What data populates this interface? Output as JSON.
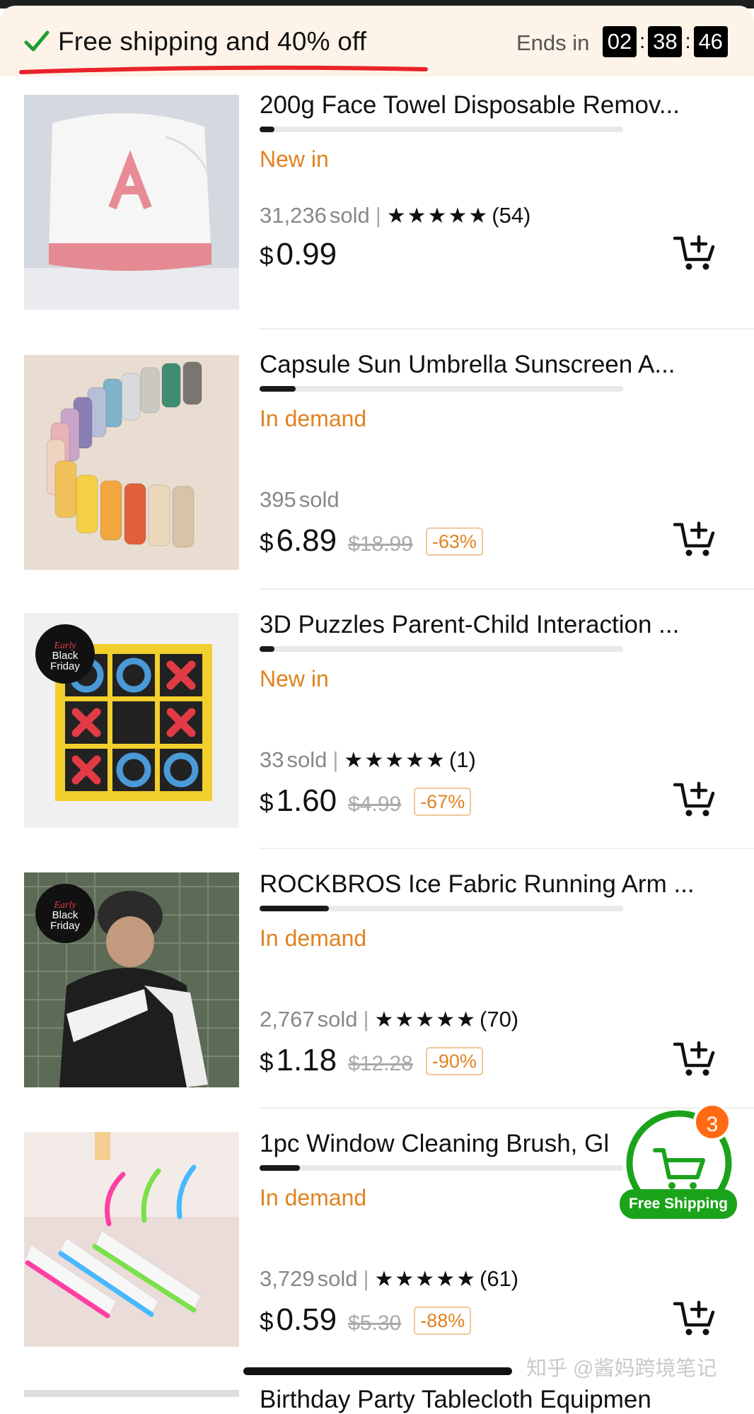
{
  "banner": {
    "shipping_text": "Free shipping and 40% off",
    "ends_label": "Ends in",
    "timer": [
      "02",
      "38",
      "46"
    ]
  },
  "products": [
    {
      "title": "200g Face Towel Disposable Remov...",
      "progress": 0.04,
      "tag": "New in",
      "sold_num": "31,236",
      "sold_label": "sold",
      "stars": "★★★★★",
      "reviews": "(54)",
      "currency": "$",
      "price": "0.99",
      "original_price": "",
      "discount": ""
    },
    {
      "title": "Capsule Sun Umbrella Sunscreen A...",
      "progress": 0.1,
      "tag": "In demand",
      "sold_num": "395",
      "sold_label": "sold",
      "stars": "",
      "reviews": "",
      "currency": "$",
      "price": "6.89",
      "original_price": "$18.99",
      "discount": "-63%"
    },
    {
      "title": "3D Puzzles Parent-Child Interaction ...",
      "progress": 0.04,
      "tag": "New in",
      "sold_num": "33",
      "sold_label": "sold",
      "stars": "★★★★★",
      "reviews": "(1)",
      "currency": "$",
      "price": "1.60",
      "original_price": "$4.99",
      "discount": "-67%"
    },
    {
      "title": "ROCKBROS Ice Fabric Running Arm ...",
      "progress": 0.19,
      "tag": "In demand",
      "sold_num": "2,767",
      "sold_label": "sold",
      "stars": "★★★★★",
      "reviews": "(70)",
      "currency": "$",
      "price": "1.18",
      "original_price": "$12.28",
      "discount": "-90%"
    },
    {
      "title": "1pc Window Cleaning Brush, Gl",
      "progress": 0.11,
      "tag": "In demand",
      "sold_num": "3,729",
      "sold_label": "sold",
      "stars": "★★★★★",
      "reviews": "(61)",
      "currency": "$",
      "price": "0.59",
      "original_price": "$5.30",
      "discount": "-88%"
    }
  ],
  "next_item": {
    "title": "Birthday Party Tablecloth Equipmen"
  },
  "float_cart": {
    "count": "3",
    "label": "Free Shipping"
  },
  "watermark": "知乎 @酱妈跨境笔记",
  "colors": {
    "accent_orange": "#e0821f",
    "banner_bg": "#fdf3e8",
    "green": "#1ca31c",
    "badge": "#ff6a13",
    "underline_red": "#e8232b"
  }
}
